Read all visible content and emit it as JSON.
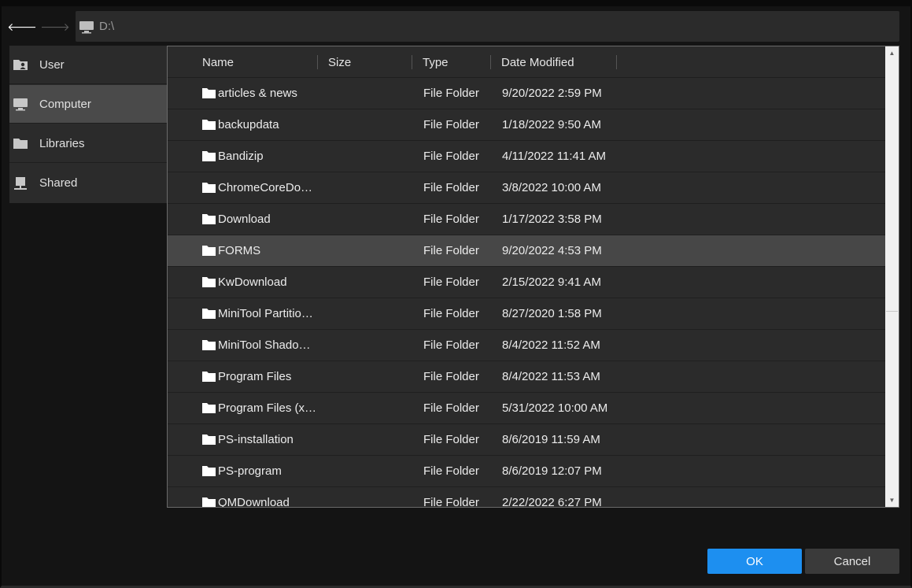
{
  "nav": {
    "back_icon": "arrow-left-icon",
    "forward_icon": "arrow-right-icon",
    "back_glyph": "🡐",
    "forward_glyph": "🡒"
  },
  "path_bar": {
    "icon": "computer-icon",
    "path": "D:\\"
  },
  "sidebar": {
    "items": [
      {
        "label": "User",
        "icon": "user-folder-icon",
        "active": false
      },
      {
        "label": "Computer",
        "icon": "computer-icon",
        "active": true
      },
      {
        "label": "Libraries",
        "icon": "folder-icon",
        "active": false
      },
      {
        "label": "Shared",
        "icon": "shared-drive-icon",
        "active": false
      }
    ]
  },
  "file_list": {
    "columns": [
      "Name",
      "Size",
      "Type",
      "Date Modified"
    ],
    "rows": [
      {
        "name": "articles & news",
        "size": "",
        "type": "File Folder",
        "date": "9/20/2022 2:59 PM"
      },
      {
        "name": "backupdata",
        "size": "",
        "type": "File Folder",
        "date": "1/18/2022 9:50 AM"
      },
      {
        "name": "Bandizip",
        "size": "",
        "type": "File Folder",
        "date": "4/11/2022 11:41 AM"
      },
      {
        "name": "ChromeCoreDo…",
        "size": "",
        "type": "File Folder",
        "date": "3/8/2022 10:00 AM"
      },
      {
        "name": "Download",
        "size": "",
        "type": "File Folder",
        "date": "1/17/2022 3:58 PM"
      },
      {
        "name": "FORMS",
        "size": "",
        "type": "File Folder",
        "date": "9/20/2022 4:53 PM",
        "selected": true
      },
      {
        "name": "KwDownload",
        "size": "",
        "type": "File Folder",
        "date": "2/15/2022 9:41 AM"
      },
      {
        "name": "MiniTool Partitio…",
        "size": "",
        "type": "File Folder",
        "date": "8/27/2020 1:58 PM"
      },
      {
        "name": "MiniTool Shado…",
        "size": "",
        "type": "File Folder",
        "date": "8/4/2022 11:52 AM"
      },
      {
        "name": "Program Files",
        "size": "",
        "type": "File Folder",
        "date": "8/4/2022 11:53 AM"
      },
      {
        "name": "Program Files (x…",
        "size": "",
        "type": "File Folder",
        "date": "5/31/2022 10:00 AM"
      },
      {
        "name": "PS-installation",
        "size": "",
        "type": "File Folder",
        "date": "8/6/2019 11:59 AM"
      },
      {
        "name": "PS-program",
        "size": "",
        "type": "File Folder",
        "date": "8/6/2019 12:07 PM"
      },
      {
        "name": "QMDownload",
        "size": "",
        "type": "File Folder",
        "date": "2/22/2022 6:27 PM"
      }
    ],
    "row_icon": "folder-icon"
  },
  "scrollbar": {
    "up_glyph": "▲",
    "down_glyph": "▼"
  },
  "buttons": {
    "ok_label": "OK",
    "cancel_label": "Cancel"
  },
  "colors": {
    "accent": "#1d8ff0",
    "panel": "#2b2b2b",
    "selected": "#474747",
    "background": "#141414"
  }
}
